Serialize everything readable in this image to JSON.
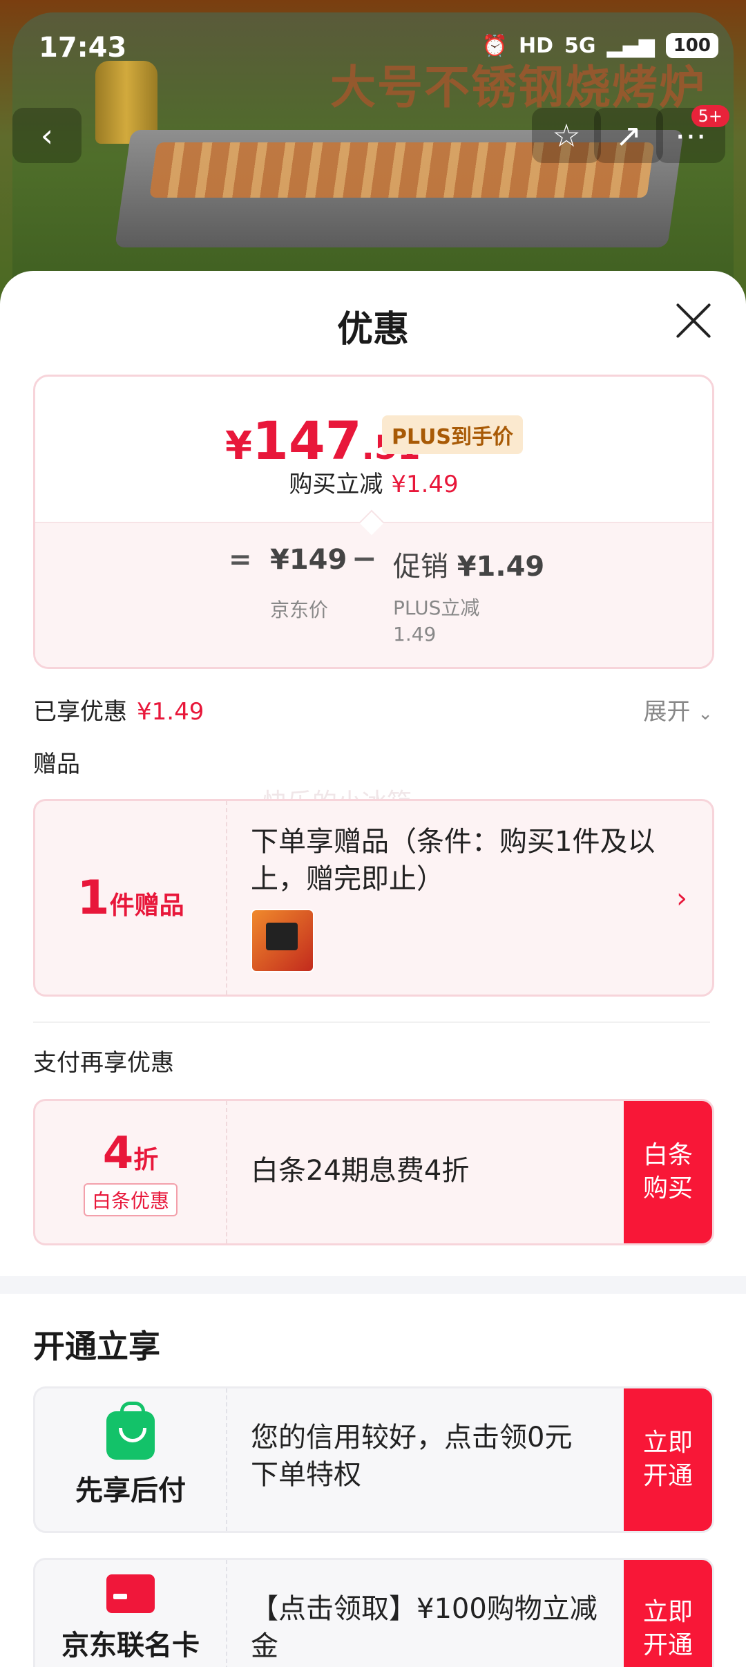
{
  "status_bar": {
    "time": "17:43",
    "hd": "HD",
    "signal": "5G",
    "battery": "100"
  },
  "background": {
    "promo_text": "大号不锈钢烧烤炉",
    "nav_badge": "5+"
  },
  "sheet": {
    "title": "优惠"
  },
  "price_card": {
    "currency": "¥",
    "price_int": "147",
    "price_dec": ".51",
    "plus_tag": "PLUS到手价",
    "instant_label": "购买立减",
    "instant_value": "¥1.49",
    "eq": "=",
    "jd_price": "¥149",
    "jd_label": "京东价",
    "minus": "−",
    "promo_label": "促销",
    "promo_value": "¥1.49",
    "plus_desc": "PLUS立减1.49"
  },
  "enjoyed": {
    "label": "已享优惠",
    "value": "¥1.49",
    "expand": "展开"
  },
  "gift": {
    "section_label": "赠品",
    "count": "1",
    "count_suffix": "件赠品",
    "text": "下单享赠品（条件：购买1件及以上，赠完即止）",
    "watermark": "快乐的小冰箱"
  },
  "pay": {
    "section_label": "支付再享优惠",
    "discount": "4",
    "discount_suffix": "折",
    "tag": "白条优惠",
    "text": "白条24期息费4折",
    "button": "白条购买"
  },
  "open": {
    "title": "开通立享",
    "items": [
      {
        "name": "先享后付",
        "text": "您的信用较好，点击领0元下单特权",
        "button": "立即开通"
      },
      {
        "name": "京东联名卡",
        "text": "【点击领取】¥100购物立减金",
        "button": "立即开通"
      }
    ]
  },
  "colors": {
    "accent": "#e8173a",
    "button_red": "#f81737",
    "plus_gold": "#a85a06",
    "green": "#13c269"
  }
}
